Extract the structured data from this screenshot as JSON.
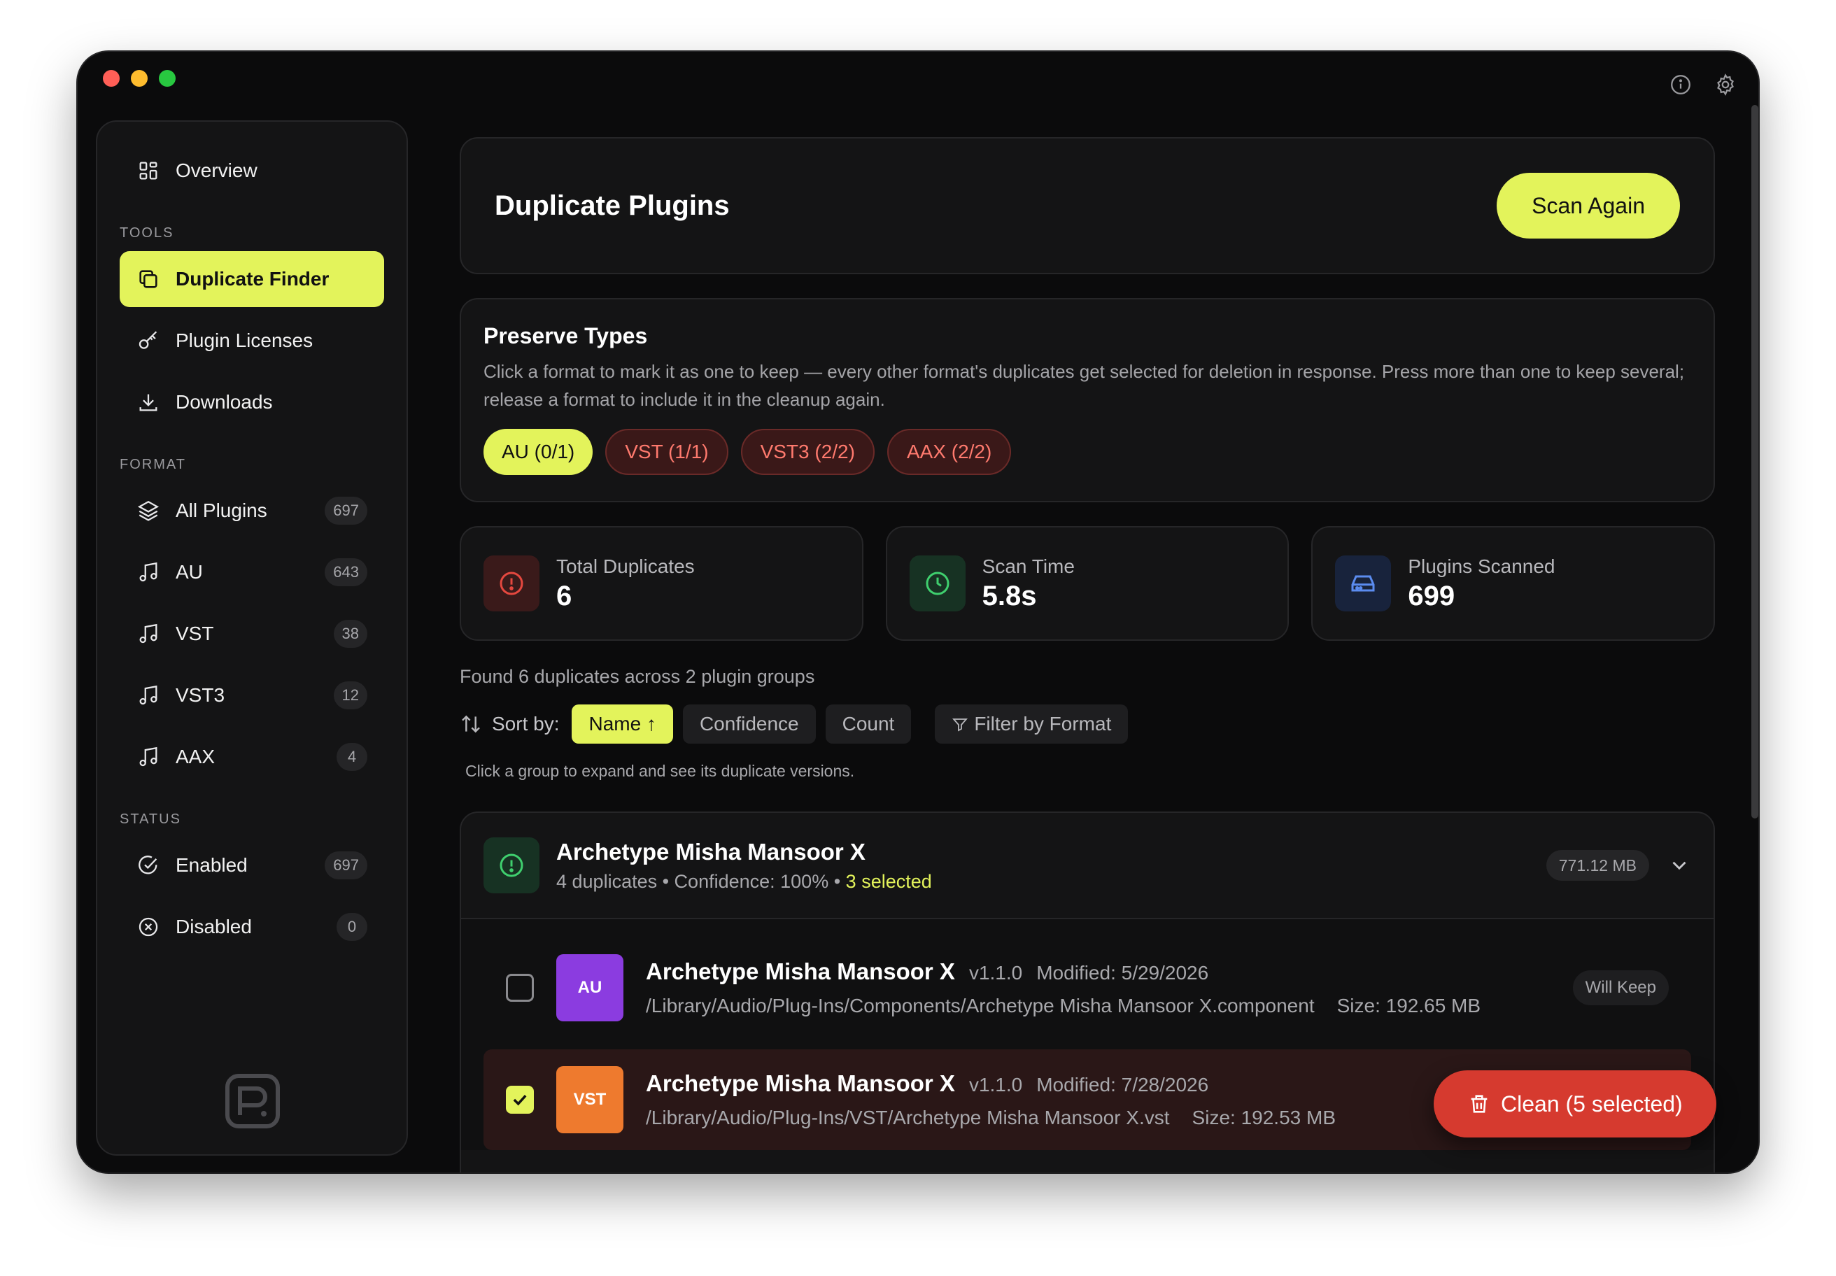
{
  "sidebar": {
    "overview": "Overview",
    "tools_heading": "TOOLS",
    "tools": [
      {
        "label": "Duplicate Finder",
        "icon": "copy-icon",
        "active": true
      },
      {
        "label": "Plugin Licenses",
        "icon": "key-icon"
      },
      {
        "label": "Downloads",
        "icon": "download-icon"
      }
    ],
    "format_heading": "FORMAT",
    "formats": [
      {
        "label": "All Plugins",
        "count": "697",
        "icon": "layers-icon"
      },
      {
        "label": "AU",
        "count": "643",
        "icon": "music-note-icon"
      },
      {
        "label": "VST",
        "count": "38",
        "icon": "music-note-icon"
      },
      {
        "label": "VST3",
        "count": "12",
        "icon": "music-note-icon"
      },
      {
        "label": "AAX",
        "count": "4",
        "icon": "music-note-icon"
      }
    ],
    "status_heading": "STATUS",
    "status": [
      {
        "label": "Enabled",
        "count": "697",
        "icon": "check-circle-icon"
      },
      {
        "label": "Disabled",
        "count": "0",
        "icon": "x-circle-icon"
      }
    ]
  },
  "header": {
    "title": "Duplicate Plugins",
    "scan_label": "Scan Again"
  },
  "preserve": {
    "title": "Preserve Types",
    "description": "Click a format to mark it as one to keep — every other format's duplicates get selected for deletion in response. Press more than one to keep several; release a format to include it in the cleanup again.",
    "chips": [
      "AU (0/1)",
      "VST (1/1)",
      "VST3 (2/2)",
      "AAX (2/2)"
    ]
  },
  "stats": [
    {
      "label": "Total Duplicates",
      "value": "6"
    },
    {
      "label": "Scan Time",
      "value": "5.8s"
    },
    {
      "label": "Plugins Scanned",
      "value": "699"
    }
  ],
  "summary": "Found 6 duplicates across 2 plugin groups",
  "sort": {
    "label": "Sort by:",
    "options": [
      "Name ↑",
      "Confidence",
      "Count"
    ],
    "filter_label": "Filter by Format"
  },
  "hint": "Click a group to expand and see its duplicate versions.",
  "group": {
    "title": "Archetype Misha Mansoor X",
    "subtitle": "4 duplicates • Confidence: 100% •",
    "selected": " 3 selected",
    "size": "771.12 MB",
    "rows": [
      {
        "format": "AU",
        "name": "Archetype Misha Mansoor X",
        "version": "v1.1.0",
        "modified": "Modified: 5/29/2026",
        "path": "/Library/Audio/Plug-Ins/Components/Archetype Misha Mansoor X.component",
        "size": "Size: 192.65 MB",
        "badge": "Will Keep"
      },
      {
        "format": "VST",
        "name": "Archetype Misha Mansoor X",
        "version": "v1.1.0",
        "modified": "Modified: 7/28/2026",
        "path": "/Library/Audio/Plug-Ins/VST/Archetype Misha Mansoor X.vst",
        "size": "Size: 192.53 MB"
      }
    ]
  },
  "clean_label": "Clean (5 selected)",
  "colors": {
    "accent": "#e3f35b",
    "danger": "#d63a2f",
    "au_tile": "#8b3ce0",
    "vst_tile": "#ee7a2e"
  }
}
